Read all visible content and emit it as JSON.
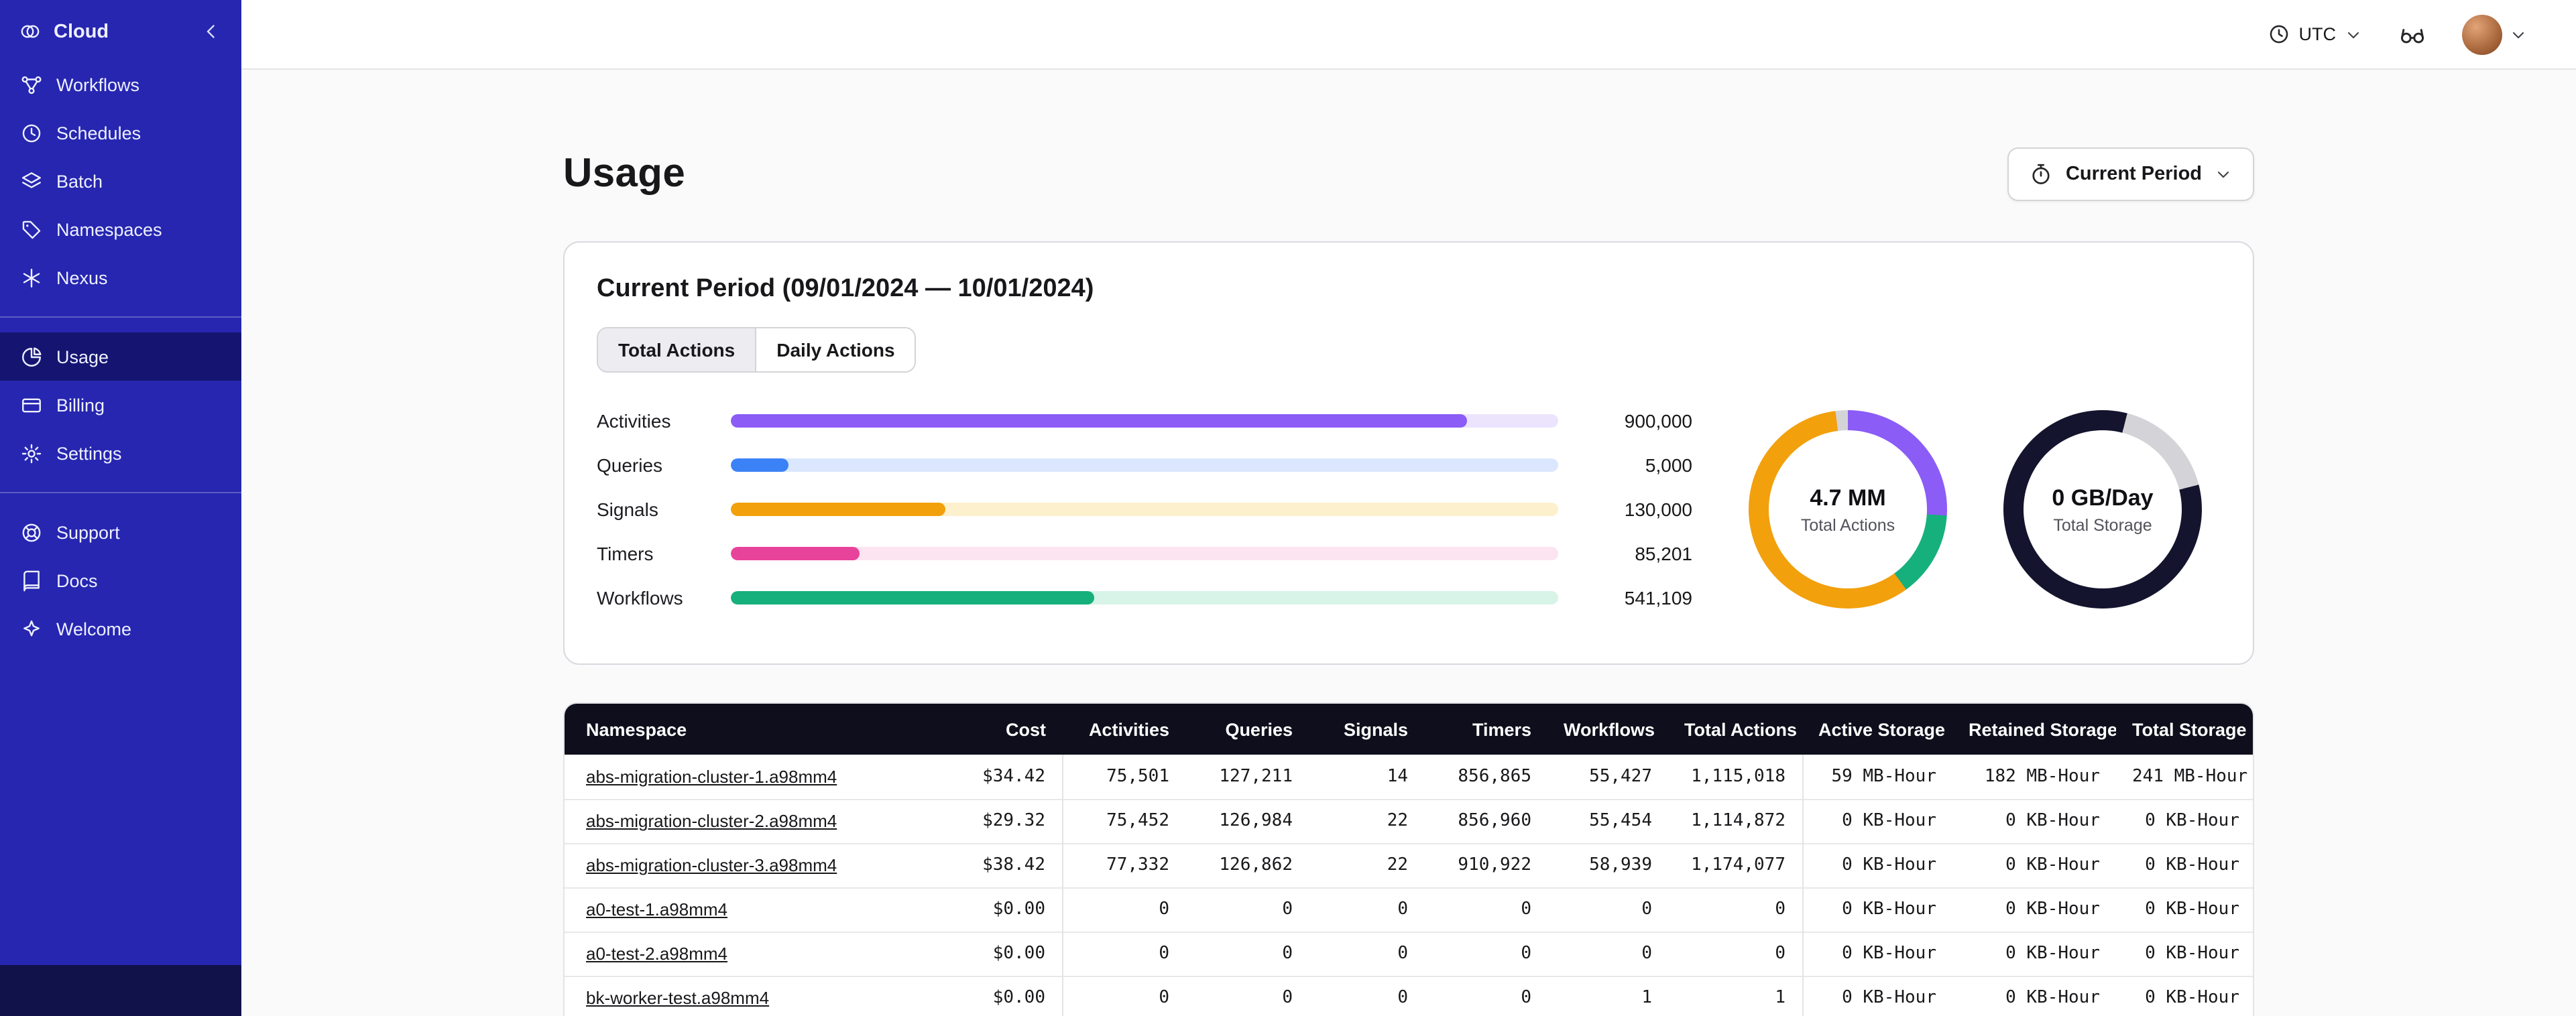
{
  "sidebar": {
    "logo_label": "Cloud",
    "selected": "Usage",
    "sections": [
      {
        "items": [
          {
            "label": "Workflows",
            "icon": "workflows"
          },
          {
            "label": "Schedules",
            "icon": "schedules"
          },
          {
            "label": "Batch",
            "icon": "batch"
          },
          {
            "label": "Namespaces",
            "icon": "namespaces"
          },
          {
            "label": "Nexus",
            "icon": "nexus"
          }
        ]
      },
      {
        "items": [
          {
            "label": "Usage",
            "icon": "usage"
          },
          {
            "label": "Billing",
            "icon": "billing"
          },
          {
            "label": "Settings",
            "icon": "settings"
          }
        ]
      },
      {
        "items": [
          {
            "label": "Support",
            "icon": "support"
          },
          {
            "label": "Docs",
            "icon": "docs"
          },
          {
            "label": "Welcome",
            "icon": "welcome"
          }
        ]
      }
    ]
  },
  "topbar": {
    "timezone": "UTC"
  },
  "page": {
    "title": "Usage",
    "period_selector": "Current Period",
    "card_title": "Current Period (09/01/2024 — 10/01/2024)",
    "tabs": [
      {
        "label": "Total Actions",
        "active": true
      },
      {
        "label": "Daily Actions",
        "active": false
      }
    ]
  },
  "chart_data": [
    {
      "type": "bar",
      "orientation": "horizontal",
      "categories": [
        "Activities",
        "Queries",
        "Signals",
        "Timers",
        "Workflows"
      ],
      "values": [
        900000,
        5000,
        130000,
        85201,
        541109
      ],
      "value_labels": [
        "900,000",
        "5,000",
        "130,000",
        "85,201",
        "541,109"
      ],
      "bar_fill_pct": [
        89,
        7,
        26,
        15.5,
        44
      ],
      "colors": [
        "#8b5cf6",
        "#3b82f6",
        "#f2a00c",
        "#e8439a",
        "#16b07c"
      ],
      "track_colors": [
        "#ece4fd",
        "#dbe7fe",
        "#fdf0cd",
        "#fce4f1",
        "#d8f3e7"
      ],
      "title": "",
      "xlabel": "",
      "ylabel": ""
    },
    {
      "type": "donut",
      "title": "Total Actions",
      "center_value": "4.7 MM",
      "segments": [
        {
          "color": "#8b5cf6",
          "pct": 26
        },
        {
          "color": "#16b07c",
          "pct": 14
        },
        {
          "color": "#f2a00c",
          "pct": 58
        },
        {
          "color": "#d4d4d8",
          "pct": 2
        }
      ]
    },
    {
      "type": "donut",
      "title": "Total Storage",
      "center_value": "0 GB/Day",
      "segments": [
        {
          "color": "#14142e",
          "pct": 4
        },
        {
          "color": "#d4d4d8",
          "pct": 17
        },
        {
          "color": "#14142e",
          "pct": 79
        }
      ]
    }
  ],
  "table": {
    "columns": [
      "Namespace",
      "Cost",
      "Activities",
      "Queries",
      "Signals",
      "Timers",
      "Workflows",
      "Total Actions",
      "Active Storage",
      "Retained Storage",
      "Total Storage"
    ],
    "rows": [
      [
        "abs-migration-cluster-1.a98mm4",
        "$34.42",
        "75,501",
        "127,211",
        "14",
        "856,865",
        "55,427",
        "1,115,018",
        "59 MB-Hour",
        "182 MB-Hour",
        "241 MB-Hour"
      ],
      [
        "abs-migration-cluster-2.a98mm4",
        "$29.32",
        "75,452",
        "126,984",
        "22",
        "856,960",
        "55,454",
        "1,114,872",
        "0 KB-Hour",
        "0 KB-Hour",
        "0 KB-Hour"
      ],
      [
        "abs-migration-cluster-3.a98mm4",
        "$38.42",
        "77,332",
        "126,862",
        "22",
        "910,922",
        "58,939",
        "1,174,077",
        "0 KB-Hour",
        "0 KB-Hour",
        "0 KB-Hour"
      ],
      [
        "a0-test-1.a98mm4",
        "$0.00",
        "0",
        "0",
        "0",
        "0",
        "0",
        "0",
        "0 KB-Hour",
        "0 KB-Hour",
        "0 KB-Hour"
      ],
      [
        "a0-test-2.a98mm4",
        "$0.00",
        "0",
        "0",
        "0",
        "0",
        "0",
        "0",
        "0 KB-Hour",
        "0 KB-Hour",
        "0 KB-Hour"
      ],
      [
        "bk-worker-test.a98mm4",
        "$0.00",
        "0",
        "0",
        "0",
        "0",
        "1",
        "1",
        "0 KB-Hour",
        "0 KB-Hour",
        "0 KB-Hour"
      ]
    ]
  }
}
